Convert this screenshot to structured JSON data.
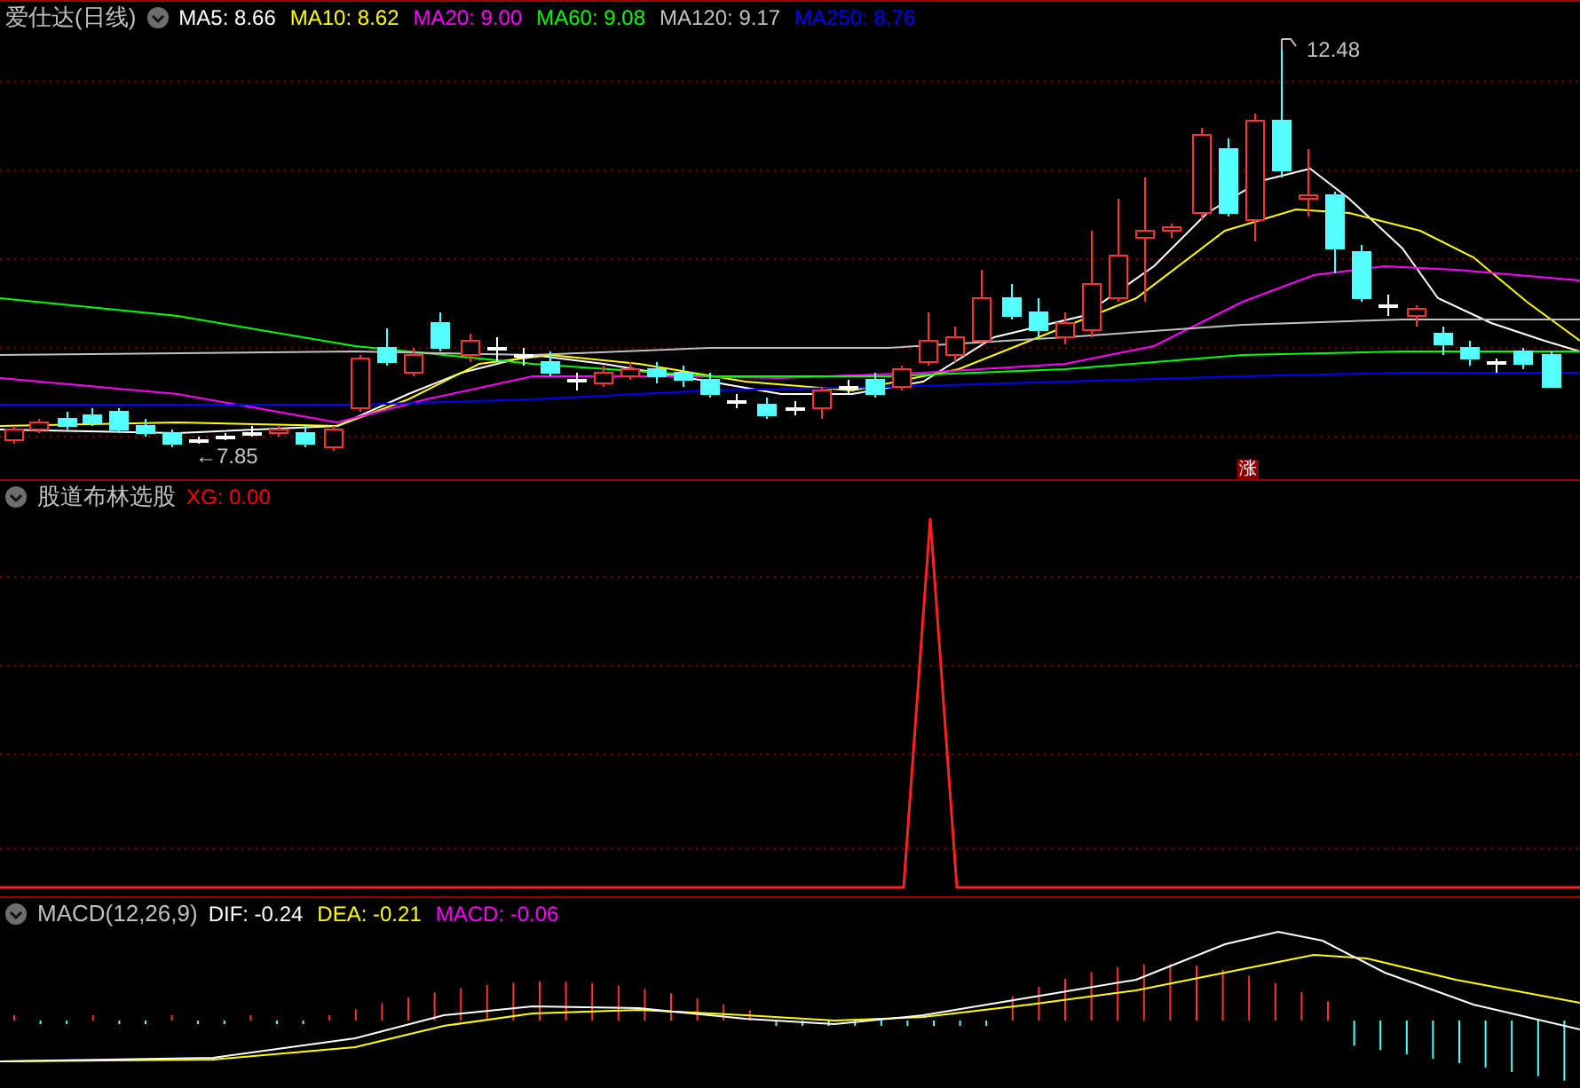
{
  "main": {
    "title": "爱仕达(日线)",
    "legend": [
      {
        "label": "MA5: 8.66",
        "color": "#ffffff"
      },
      {
        "label": "MA10: 8.62",
        "color": "#ffff00"
      },
      {
        "label": "MA20: 9.00",
        "color": "#ff00ff"
      },
      {
        "label": "MA60: 9.08",
        "color": "#00ff00"
      },
      {
        "label": "MA120: 9.17",
        "color": "#c0c0c0"
      },
      {
        "label": "MA250: 8.76",
        "color": "#0000ff"
      }
    ],
    "high_label": "12.48",
    "low_label": "←7.85",
    "badge": "涨"
  },
  "indicator": {
    "title": "股道布林选股",
    "legend": [
      {
        "label": "XG: 0.00",
        "color": "#ff0000"
      }
    ]
  },
  "macd": {
    "title": "MACD(12,26,9)",
    "legend": [
      {
        "label": "DIF: -0.24",
        "color": "#ffffff"
      },
      {
        "label": "DEA: -0.21",
        "color": "#ffff00"
      },
      {
        "label": "MACD: -0.06",
        "color": "#ff00ff"
      }
    ]
  }
}
